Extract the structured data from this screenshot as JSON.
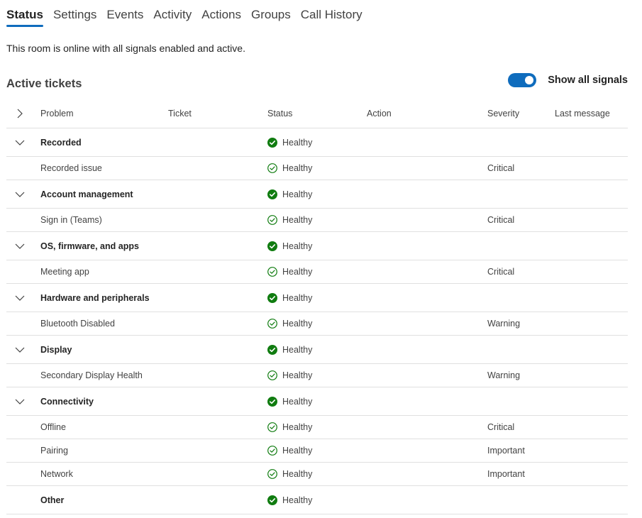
{
  "tabs": [
    "Status",
    "Settings",
    "Events",
    "Activity",
    "Actions",
    "Groups",
    "Call History"
  ],
  "active_tab": "Status",
  "summary": "This room is online with all signals enabled and active.",
  "section_title": "Active tickets",
  "toggle": {
    "label": "Show all signals",
    "on": true
  },
  "columns": {
    "problem": "Problem",
    "ticket": "Ticket",
    "status": "Status",
    "action": "Action",
    "severity": "Severity",
    "last_message": "Last message"
  },
  "rows": [
    {
      "kind": "group",
      "problem": "Recorded",
      "status": "Healthy",
      "severity": ""
    },
    {
      "kind": "child",
      "problem": "Recorded issue",
      "status": "Healthy",
      "severity": "Critical"
    },
    {
      "kind": "group",
      "problem": "Account management",
      "status": "Healthy",
      "severity": ""
    },
    {
      "kind": "child",
      "problem": "Sign in (Teams)",
      "status": "Healthy",
      "severity": "Critical"
    },
    {
      "kind": "group",
      "problem": "OS, firmware, and apps",
      "status": "Healthy",
      "severity": ""
    },
    {
      "kind": "child",
      "problem": "Meeting app",
      "status": "Healthy",
      "severity": "Critical"
    },
    {
      "kind": "group",
      "problem": "Hardware and peripherals",
      "status": "Healthy",
      "severity": ""
    },
    {
      "kind": "child",
      "problem": "Bluetooth Disabled",
      "status": "Healthy",
      "severity": "Warning"
    },
    {
      "kind": "group",
      "problem": "Display",
      "status": "Healthy",
      "severity": ""
    },
    {
      "kind": "child",
      "problem": "Secondary Display Health",
      "status": "Healthy",
      "severity": "Warning"
    },
    {
      "kind": "group",
      "problem": "Connectivity",
      "status": "Healthy",
      "severity": ""
    },
    {
      "kind": "child",
      "problem": "Offline",
      "status": "Healthy",
      "severity": "Critical"
    },
    {
      "kind": "child",
      "problem": "Pairing",
      "status": "Healthy",
      "severity": "Important"
    },
    {
      "kind": "child",
      "problem": "Network",
      "status": "Healthy",
      "severity": "Important"
    },
    {
      "kind": "group-noexpand",
      "problem": "Other",
      "status": "Healthy",
      "severity": ""
    }
  ],
  "colors": {
    "accent": "#0f6cbd",
    "healthy": "#107c10"
  },
  "icons": {
    "header_expander": "chevron-right-icon",
    "group_expander": "chevron-down-icon",
    "group_status": "healthy-filled-check-icon",
    "child_status": "healthy-outline-check-icon"
  }
}
